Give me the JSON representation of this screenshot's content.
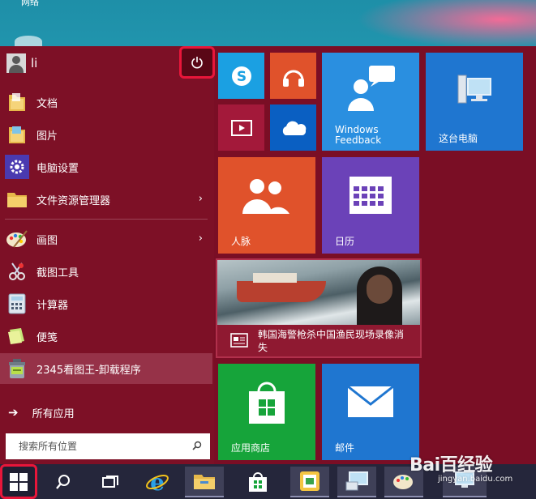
{
  "desktop": {
    "top_label": "网络"
  },
  "user": {
    "name": "li"
  },
  "left_menu": {
    "items": [
      {
        "label": "文档",
        "icon": "folder-documents-icon",
        "arrow": ""
      },
      {
        "label": "图片",
        "icon": "folder-pictures-icon",
        "arrow": ""
      },
      {
        "label": "电脑设置",
        "icon": "gear-icon",
        "arrow": ""
      },
      {
        "label": "文件资源管理器",
        "icon": "file-explorer-icon",
        "arrow": "›"
      },
      {
        "label": "画图",
        "icon": "paint-palette-icon",
        "arrow": "›"
      },
      {
        "label": "截图工具",
        "icon": "scissors-icon",
        "arrow": ""
      },
      {
        "label": "计算器",
        "icon": "calculator-icon",
        "arrow": ""
      },
      {
        "label": "便笺",
        "icon": "sticky-note-icon",
        "arrow": ""
      },
      {
        "label": "2345看图王-卸载程序",
        "icon": "uninstall-icon",
        "arrow": ""
      }
    ],
    "all_apps_arrow": "➔",
    "all_apps_label": "所有应用"
  },
  "search": {
    "placeholder": "搜索所有位置"
  },
  "tiles": {
    "windows_feedback": "Windows Feedback",
    "this_pc": "这台电脑",
    "people": "人脉",
    "calendar": "日历",
    "news_headline": "韩国海警枪杀中国渔民现场录像消失",
    "store": "应用商店",
    "mail": "邮件"
  },
  "colors": {
    "start_bg": "#7a0e25",
    "skype": "#1ba0e2",
    "music": "#e0522b",
    "video": "#a3193a",
    "onedrive": "#0a5fc2",
    "feedback": "#2a8fe0",
    "this_pc": "#1f76d0",
    "people": "#e0522b",
    "calendar": "#6b42b8",
    "store": "#16a43a",
    "mail": "#1f76d0",
    "highlight": "#e8163a"
  },
  "watermark": {
    "brand": "Bai百经验",
    "url": "jingyan.baidu.com"
  }
}
